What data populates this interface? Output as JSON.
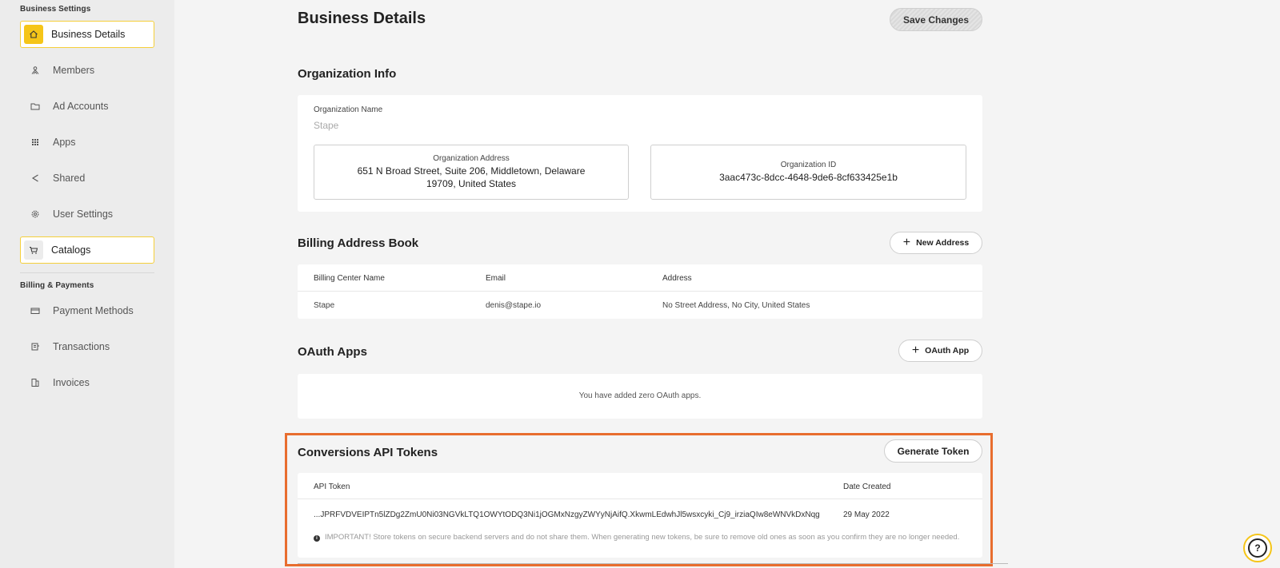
{
  "sidebar": {
    "section_business": "Business Settings",
    "section_billing": "Billing & Payments",
    "items": [
      {
        "label": "Business Details",
        "icon": "home-icon"
      },
      {
        "label": "Members",
        "icon": "members-icon"
      },
      {
        "label": "Ad Accounts",
        "icon": "folder-icon"
      },
      {
        "label": "Apps",
        "icon": "grid-icon"
      },
      {
        "label": "Shared",
        "icon": "share-icon"
      },
      {
        "label": "User Settings",
        "icon": "gear-icon"
      },
      {
        "label": "Catalogs",
        "icon": "cart-icon"
      }
    ],
    "billing_items": [
      {
        "label": "Payment Methods",
        "icon": "credit-card-icon"
      },
      {
        "label": "Transactions",
        "icon": "receipt-icon"
      },
      {
        "label": "Invoices",
        "icon": "invoice-icon"
      }
    ]
  },
  "header": {
    "title": "Business Details",
    "save_label": "Save Changes"
  },
  "org_info": {
    "title": "Organization Info",
    "name_label": "Organization Name",
    "name_value": "Stape",
    "address_label": "Organization Address",
    "address_line1": "651 N Broad Street, Suite 206, Middletown, Delaware",
    "address_line2": "19709, United States",
    "id_label": "Organization ID",
    "id_value": "3aac473c-8dcc-4648-9de6-8cf633425e1b"
  },
  "billing": {
    "title": "Billing Address Book",
    "new_address_label": "New Address",
    "columns": [
      "Billing Center Name",
      "Email",
      "Address"
    ],
    "rows": [
      [
        "Stape",
        "denis@stape.io",
        "No Street Address, No City, United States"
      ]
    ]
  },
  "oauth": {
    "title": "OAuth Apps",
    "add_label": "OAuth App",
    "empty_text": "You have added zero OAuth apps."
  },
  "capi": {
    "title": "Conversions API Tokens",
    "generate_label": "Generate Token",
    "columns": [
      "API Token",
      "Date Created"
    ],
    "rows": [
      [
        "...JPRFVDVEIPTn5lZDg2ZmU0Ni03NGVkLTQ1OWYtODQ3Ni1jOGMxNzgyZWYyNjAifQ.XkwmLEdwhJl5wsxcyki_Cj9_irziaQIw8eWNVkDxNqg",
        "29 May 2022"
      ]
    ],
    "notice": "IMPORTANT! Store tokens on secure backend servers and do not share them. When generating new tokens, be sure to remove old ones as soon as you confirm they are no longer needed.",
    "highlight_color": "#e86d2e"
  },
  "colors": {
    "accent": "#f5c518"
  }
}
